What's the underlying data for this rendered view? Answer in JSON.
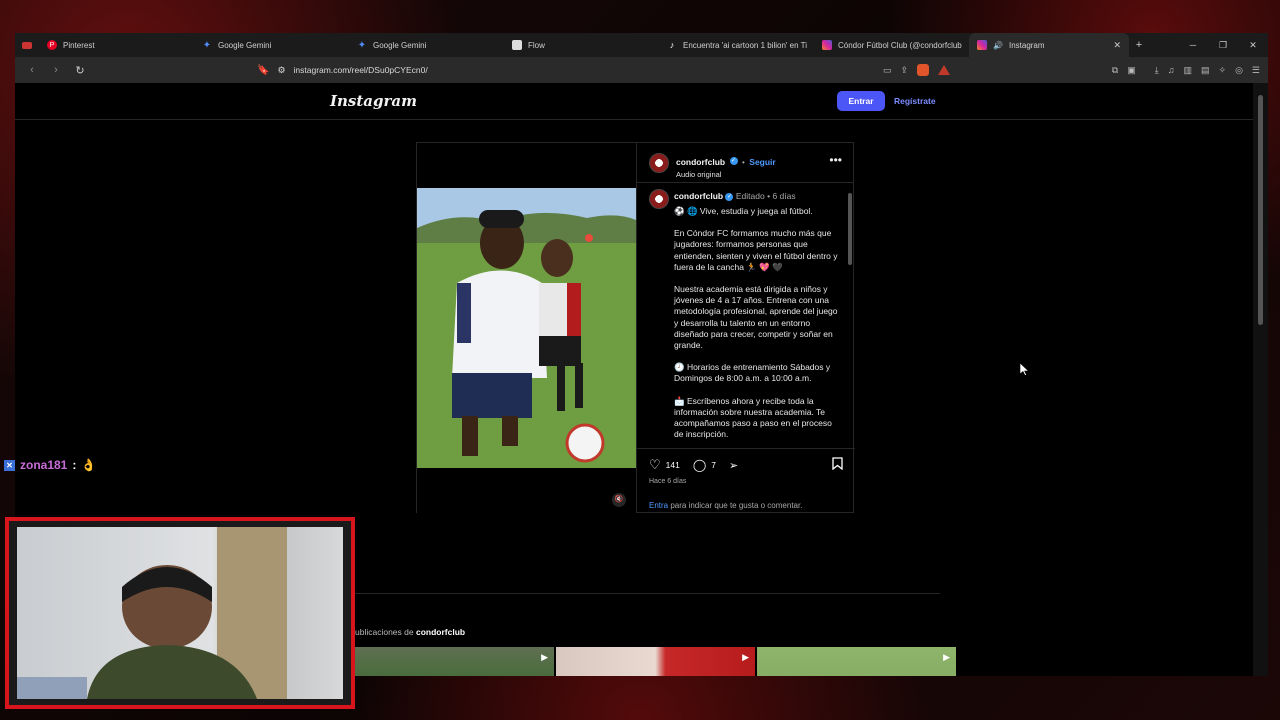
{
  "tabs": [
    {
      "label": "Pinterest",
      "icon": "pinterest-icon",
      "color": "#e60023"
    },
    {
      "label": "Google Gemini",
      "icon": "gemini-icon",
      "color": "#4f8cf7"
    },
    {
      "label": "Google Gemini",
      "icon": "gemini-icon",
      "color": "#4f8cf7"
    },
    {
      "label": "Flow",
      "icon": "flow-icon",
      "color": "#dddddd"
    },
    {
      "label": "Encuentra 'ai cartoon 1 bilion' en Ti",
      "icon": "tiktok-icon",
      "color": "#ffffff"
    },
    {
      "label": "Cóndor Fútbol Club (@condorfclub",
      "icon": "instagram-icon",
      "color": "#d6249f"
    },
    {
      "label": "Instagram",
      "icon": "instagram-icon",
      "color": "#d6249f",
      "active": true
    }
  ],
  "browser": {
    "url": "instagram.com/reel/DSu0pCYEcn0/",
    "window_controls": [
      "─",
      "❐",
      "✕"
    ]
  },
  "instagram": {
    "logo": "Instagram",
    "login_button": "Entrar",
    "signup_link": "Regístrate"
  },
  "post": {
    "username": "condorfclub",
    "follow": "Seguir",
    "audio": "Audio original",
    "caption_header": {
      "username": "condorfclub",
      "edited": "Editado",
      "time": "6 días"
    },
    "caption_lines": [
      "⚽ 🌐 Vive, estudia y juega al fútbol.",
      "En Cóndor FC formamos mucho más que jugadores: formamos personas que entienden, sienten y viven el fútbol dentro y fuera de la cancha 🏃 💖 🖤",
      "Nuestra academia está dirigida a niños y jóvenes de 4 a 17 años. Entrena con una metodología profesional, aprende del juego y desarrolla tu talento en un entorno diseñado para crecer, competir y soñar en grande.",
      "🕗 Horarios de entrenamiento Sábados y Domingos  de 8:00 a.m. a 10:00 a.m.",
      "📩 Escríbenos ahora y recibe toda la información sobre nuestra academia. Te acompañamos paso a paso en el proceso de inscripción."
    ],
    "likes": "141",
    "comments": "7",
    "posted": "Hace 6 días",
    "login_prompt_link": "Entra",
    "login_prompt_text": " para indicar que te gusta o comentar."
  },
  "more_posts": {
    "title_prefix": "ublicaciones de ",
    "title_user": "condorfclub"
  },
  "stream": {
    "chat_user": "zona181",
    "chat_sep": ":",
    "chat_msg": "👌"
  }
}
